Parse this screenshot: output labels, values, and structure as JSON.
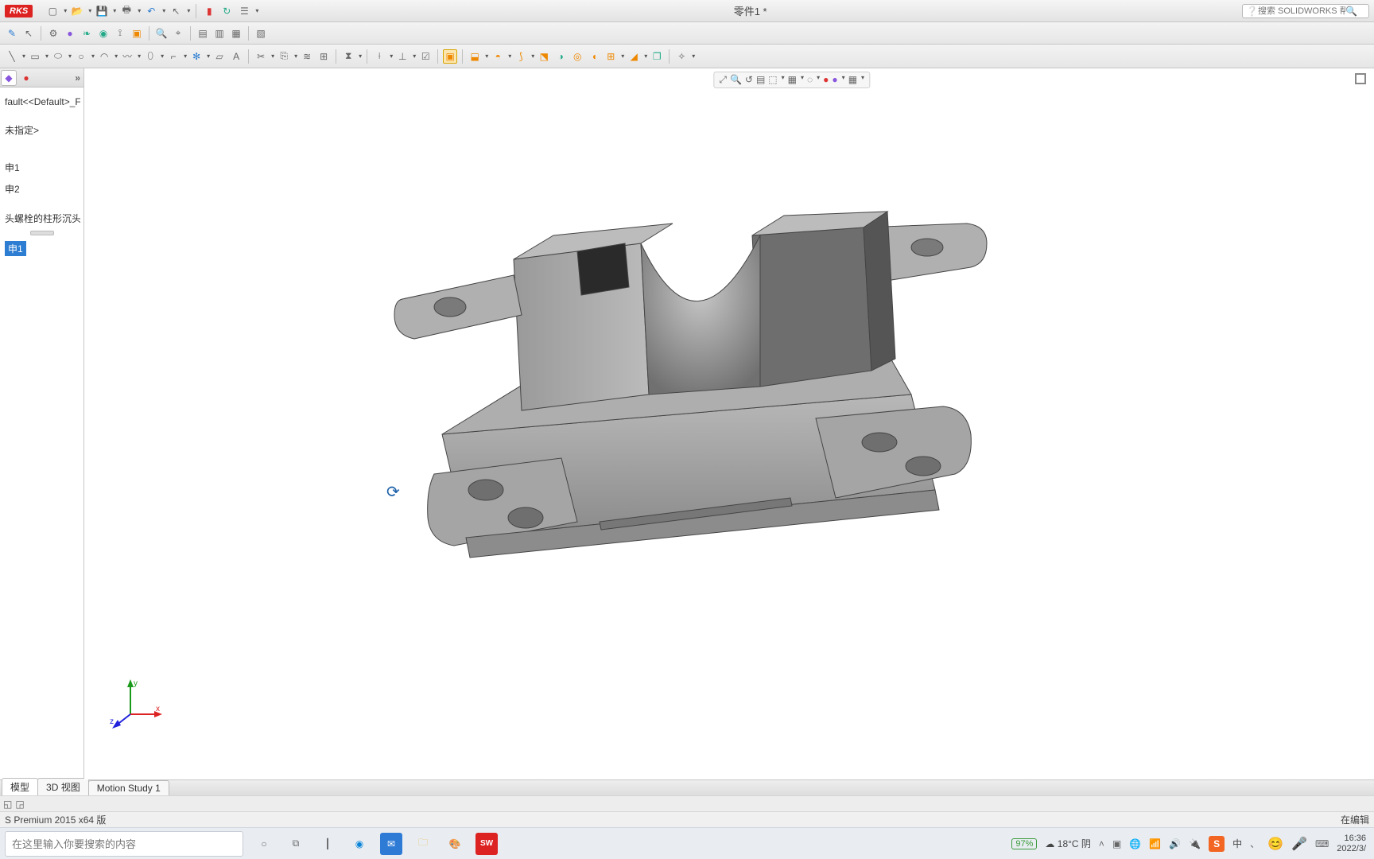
{
  "title": "零件1 *",
  "search_help_placeholder": "搜索 SOLIDWORKS 帮助",
  "tree": {
    "root": "fault<<Default>_F",
    "items": [
      "",
      "未指定>",
      "",
      "",
      "申1",
      "申2",
      "",
      "头螺栓的柱形沉头"
    ],
    "selected": "申1"
  },
  "model_tabs": {
    "t1": "模型",
    "t2": "3D 视图",
    "t3": "Motion Study 1"
  },
  "status": {
    "left": "S Premium 2015 x64 版",
    "right": "在编辑"
  },
  "taskbar": {
    "search_placeholder": "在这里输入你要搜索的内容",
    "battery": "97%",
    "weather": "18°C 阴",
    "ime": "中",
    "time": "16:36",
    "date": "2022/3/"
  },
  "triad": {
    "x": "x",
    "y": "y",
    "z": "z"
  },
  "icons": {
    "new": "new",
    "open": "open",
    "save": "save",
    "print": "print",
    "undo": "undo",
    "select": "select",
    "rec": "rec",
    "rebuild": "rebuild",
    "options": "options",
    "r2": [
      "edit-sketch",
      "gear",
      "sphere",
      "leaf",
      "bullet",
      "ruler",
      "box",
      "zoom",
      "binoc",
      "sheet1",
      "sheet2",
      "sheet3",
      "sheet4"
    ],
    "sk": [
      "line",
      "rect",
      "slot",
      "circle",
      "arc",
      "spline",
      "ellipse",
      "fillet",
      "point",
      "plane",
      "text",
      "trim",
      "convert",
      "offset",
      "mirror",
      "pattern",
      "dim",
      "rel",
      "repair",
      "quick",
      "display"
    ],
    "feat": [
      "extrude",
      "revolve",
      "sweep",
      "loft",
      "cut-ext",
      "cut-rev",
      "hole",
      "fillet-f",
      "chamfer",
      "rib",
      "draft",
      "shell",
      "pattern-l",
      "pattern-c",
      "mirror-f",
      "ref",
      "curves"
    ],
    "view": [
      "zoom-fit",
      "zoom-area",
      "prev",
      "section",
      "view-or",
      "display-s",
      "scene",
      "appear",
      "decal",
      "render",
      "hide"
    ]
  }
}
